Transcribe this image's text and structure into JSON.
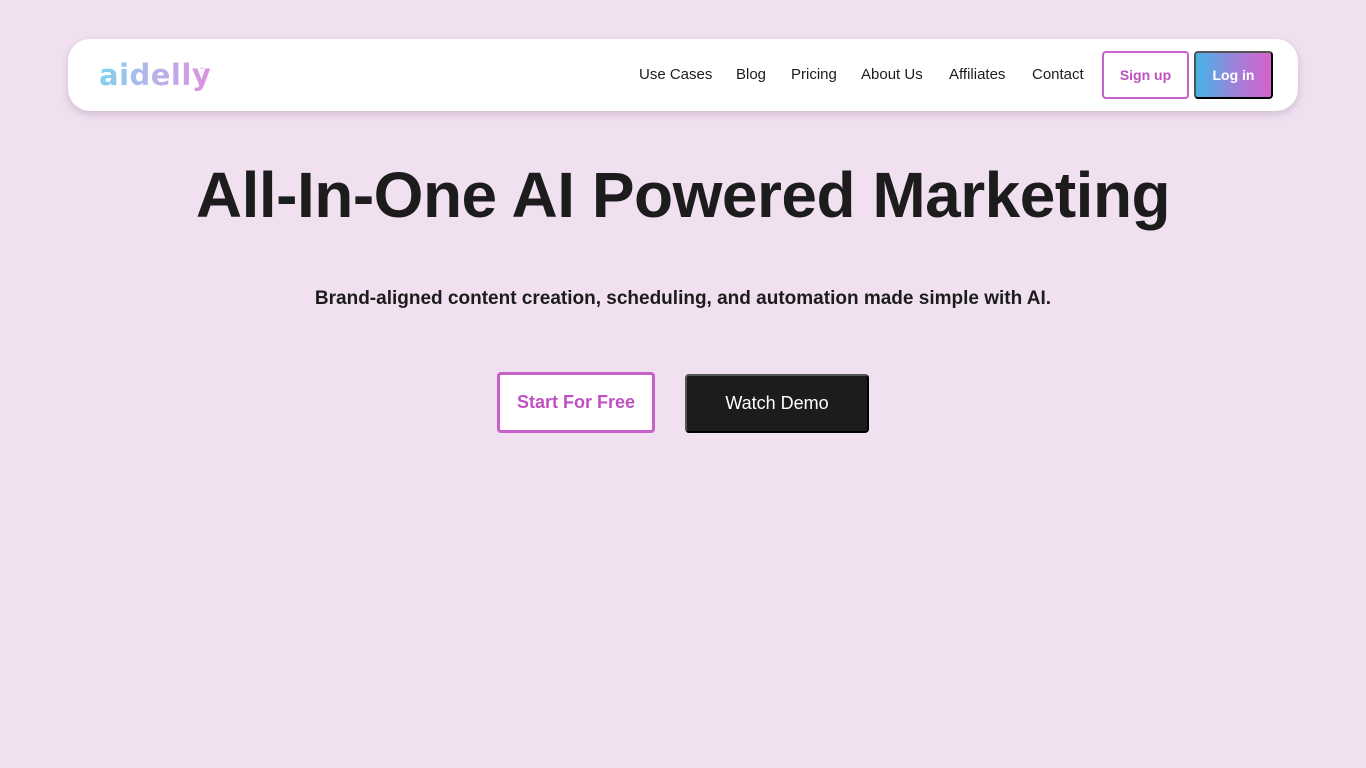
{
  "header": {
    "logo_text": "aidelly",
    "logo_tm": "™",
    "nav": [
      {
        "label": "Use Cases"
      },
      {
        "label": "Blog"
      },
      {
        "label": "Pricing"
      },
      {
        "label": "About Us"
      },
      {
        "label": "Affiliates"
      },
      {
        "label": "Contact"
      }
    ],
    "signup_label": "Sign up",
    "login_label": "Log in"
  },
  "hero": {
    "title": "All-In-One AI Powered Marketing",
    "subtitle": "Brand-aligned content creation, scheduling, and automation made simple with AI.",
    "primary_cta": "Start For Free",
    "secondary_cta": "Watch Demo"
  },
  "colors": {
    "background": "#f0e0f0",
    "accent": "#c861c9",
    "login_gradient_start": "#43b4e8",
    "login_gradient_end": "#d562ca",
    "dark_button": "#1c1c1c"
  }
}
